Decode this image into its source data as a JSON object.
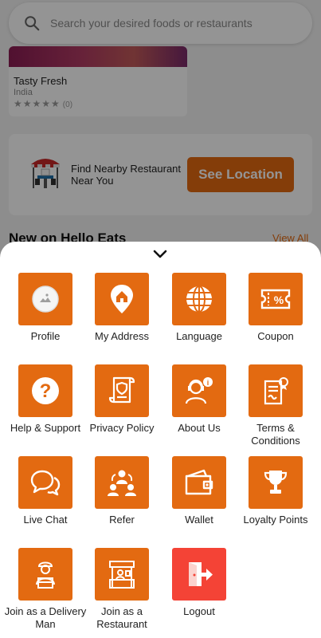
{
  "colors": {
    "accent": "#e36a11",
    "logout": "#f44336"
  },
  "search": {
    "placeholder": "Search your desired foods or restaurants",
    "icon": "search-icon"
  },
  "restaurant_card": {
    "name": "Tasty Fresh",
    "location": "India",
    "stars": "★★★★★",
    "rating_count": "(0)"
  },
  "nearby": {
    "text": "Find Nearby Restaurant Near You",
    "button": "See Location"
  },
  "section": {
    "title": "New on Hello Eats",
    "view_all": "View All"
  },
  "menu": {
    "items": [
      {
        "label": "Profile",
        "icon": "profile-avatar-icon"
      },
      {
        "label": "My Address",
        "icon": "location-home-icon"
      },
      {
        "label": "Language",
        "icon": "globe-icon"
      },
      {
        "label": "Coupon",
        "icon": "coupon-icon"
      },
      {
        "label": "Help & Support",
        "icon": "question-icon"
      },
      {
        "label": "Privacy Policy",
        "icon": "policy-document-icon"
      },
      {
        "label": "About Us",
        "icon": "support-agent-icon"
      },
      {
        "label": "Terms & Conditions",
        "icon": "terms-document-icon"
      },
      {
        "label": "Live Chat",
        "icon": "chat-bubbles-icon"
      },
      {
        "label": "Refer",
        "icon": "refer-people-icon"
      },
      {
        "label": "Wallet",
        "icon": "wallet-icon"
      },
      {
        "label": "Loyalty Points",
        "icon": "trophy-icon"
      },
      {
        "label": "Join as a Delivery Man",
        "icon": "delivery-man-icon"
      },
      {
        "label": "Join as a Restaurant",
        "icon": "restaurant-stall-icon"
      },
      {
        "label": "Logout",
        "icon": "logout-icon"
      }
    ]
  }
}
